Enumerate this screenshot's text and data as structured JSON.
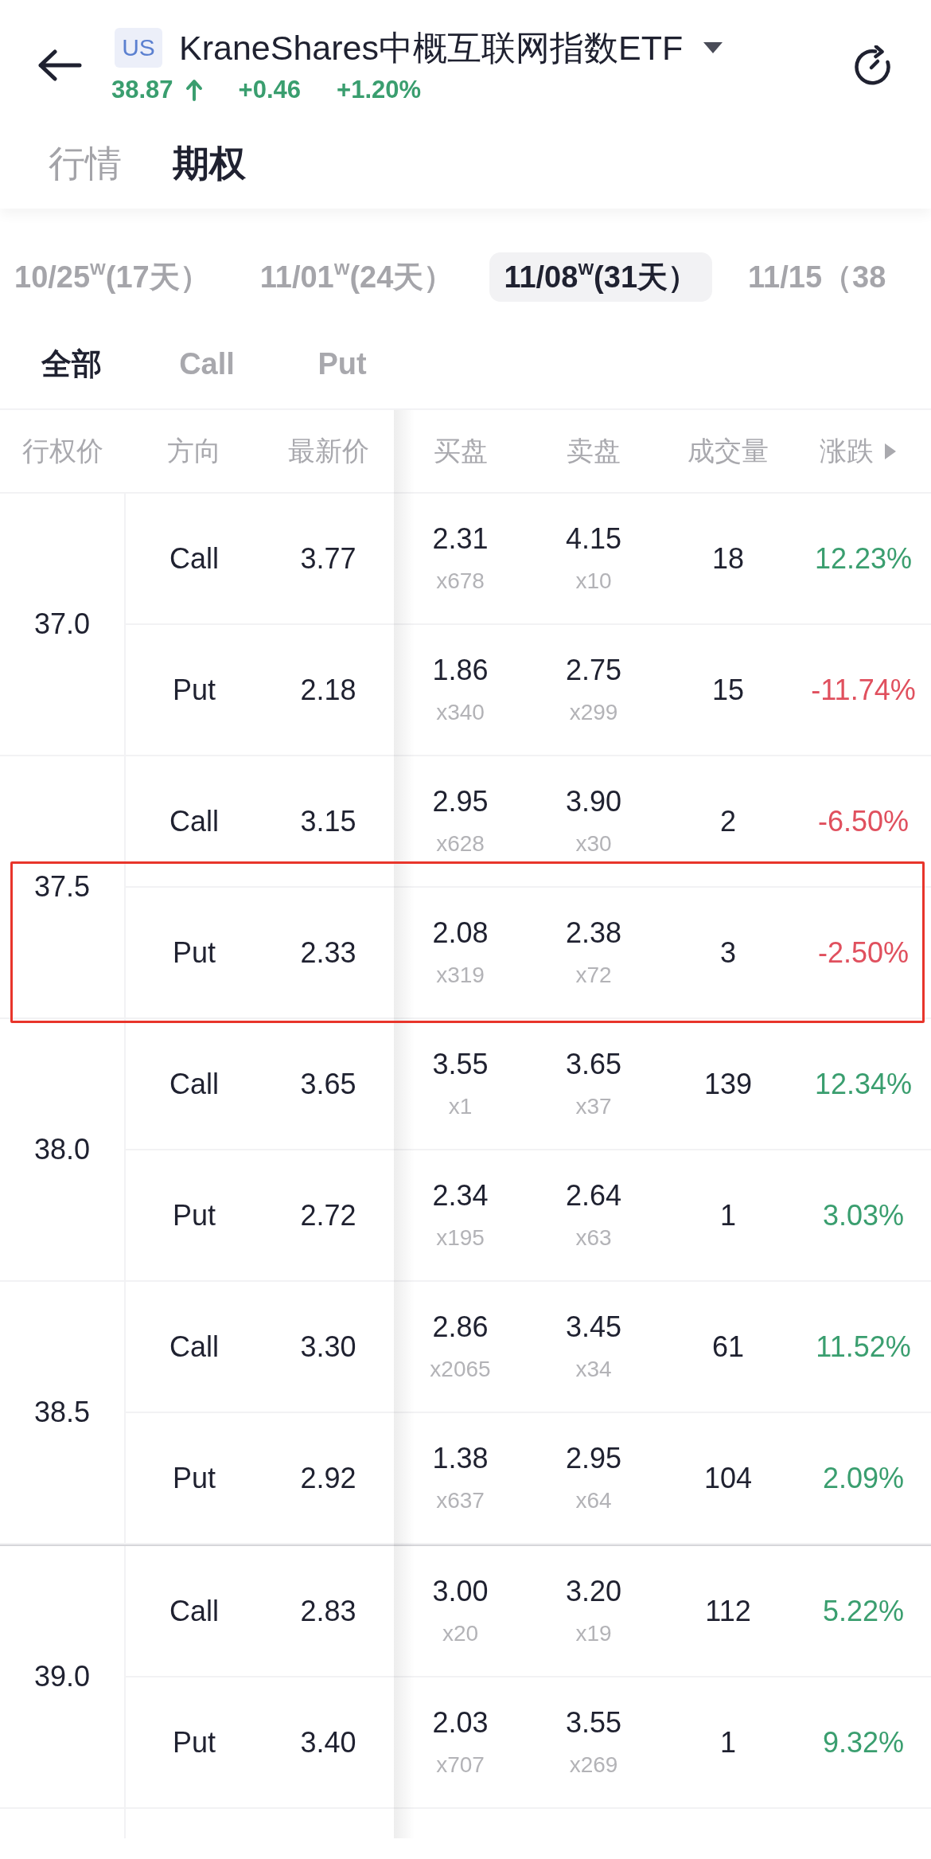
{
  "header": {
    "badge": "US",
    "title": "KraneShares中概互联网指数ETF",
    "quote": {
      "price": "38.87",
      "rising": true,
      "change": "+0.46",
      "change_pct": "+1.20%"
    }
  },
  "tabs": [
    {
      "label": "行情",
      "selected": false
    },
    {
      "label": "期权",
      "selected": true
    }
  ],
  "expiries": [
    {
      "label": "10/25$^{W}$(17天）",
      "selected": false
    },
    {
      "label": "11/01$^{W}$(24天）",
      "selected": false
    },
    {
      "label": "11/08$^{W}$(31天）",
      "selected": true
    },
    {
      "label": "11/15（38",
      "selected": false
    }
  ],
  "filters": [
    {
      "label": "全部",
      "selected": true
    },
    {
      "label": "Call",
      "selected": false
    },
    {
      "label": "Put",
      "selected": false
    }
  ],
  "table": {
    "columns": [
      "行权价",
      "方向",
      "最新价",
      "买盘",
      "卖盘",
      "成交量",
      "涨跌"
    ],
    "groups": [
      {
        "strike": "37.0",
        "price_divider_above": false,
        "options": [
          {
            "side": "Call",
            "last": "3.77",
            "bid": "2.31",
            "bid_size": "x678",
            "ask": "4.15",
            "ask_size": "x10",
            "volume": "18",
            "change_pct": "12.23%",
            "rising": true,
            "highlighted": false
          },
          {
            "side": "Put",
            "last": "2.18",
            "bid": "1.86",
            "bid_size": "x340",
            "ask": "2.75",
            "ask_size": "x299",
            "volume": "15",
            "change_pct": "-11.74%",
            "rising": false,
            "highlighted": false
          }
        ]
      },
      {
        "strike": "37.5",
        "price_divider_above": false,
        "options": [
          {
            "side": "Call",
            "last": "3.15",
            "bid": "2.95",
            "bid_size": "x628",
            "ask": "3.90",
            "ask_size": "x30",
            "volume": "2",
            "change_pct": "-6.50%",
            "rising": false,
            "highlighted": false
          },
          {
            "side": "Put",
            "last": "2.33",
            "bid": "2.08",
            "bid_size": "x319",
            "ask": "2.38",
            "ask_size": "x72",
            "volume": "3",
            "change_pct": "-2.50%",
            "rising": false,
            "highlighted": true
          }
        ]
      },
      {
        "strike": "38.0",
        "price_divider_above": false,
        "options": [
          {
            "side": "Call",
            "last": "3.65",
            "bid": "3.55",
            "bid_size": "x1",
            "ask": "3.65",
            "ask_size": "x37",
            "volume": "139",
            "change_pct": "12.34%",
            "rising": true,
            "highlighted": false
          },
          {
            "side": "Put",
            "last": "2.72",
            "bid": "2.34",
            "bid_size": "x195",
            "ask": "2.64",
            "ask_size": "x63",
            "volume": "1",
            "change_pct": "3.03%",
            "rising": true,
            "highlighted": false
          }
        ]
      },
      {
        "strike": "38.5",
        "price_divider_above": false,
        "options": [
          {
            "side": "Call",
            "last": "3.30",
            "bid": "2.86",
            "bid_size": "x2065",
            "ask": "3.45",
            "ask_size": "x34",
            "volume": "61",
            "change_pct": "11.52%",
            "rising": true,
            "highlighted": false
          },
          {
            "side": "Put",
            "last": "2.92",
            "bid": "1.38",
            "bid_size": "x637",
            "ask": "2.95",
            "ask_size": "x64",
            "volume": "104",
            "change_pct": "2.09%",
            "rising": true,
            "highlighted": false
          }
        ]
      },
      {
        "strike": "39.0",
        "price_divider_above": true,
        "options": [
          {
            "side": "Call",
            "last": "2.83",
            "bid": "3.00",
            "bid_size": "x20",
            "ask": "3.20",
            "ask_size": "x19",
            "volume": "112",
            "change_pct": "5.22%",
            "rising": true,
            "highlighted": false
          },
          {
            "side": "Put",
            "last": "3.40",
            "bid": "2.03",
            "bid_size": "x707",
            "ask": "3.55",
            "ask_size": "x269",
            "volume": "1",
            "change_pct": "9.32%",
            "rising": true,
            "highlighted": false
          }
        ]
      }
    ]
  }
}
